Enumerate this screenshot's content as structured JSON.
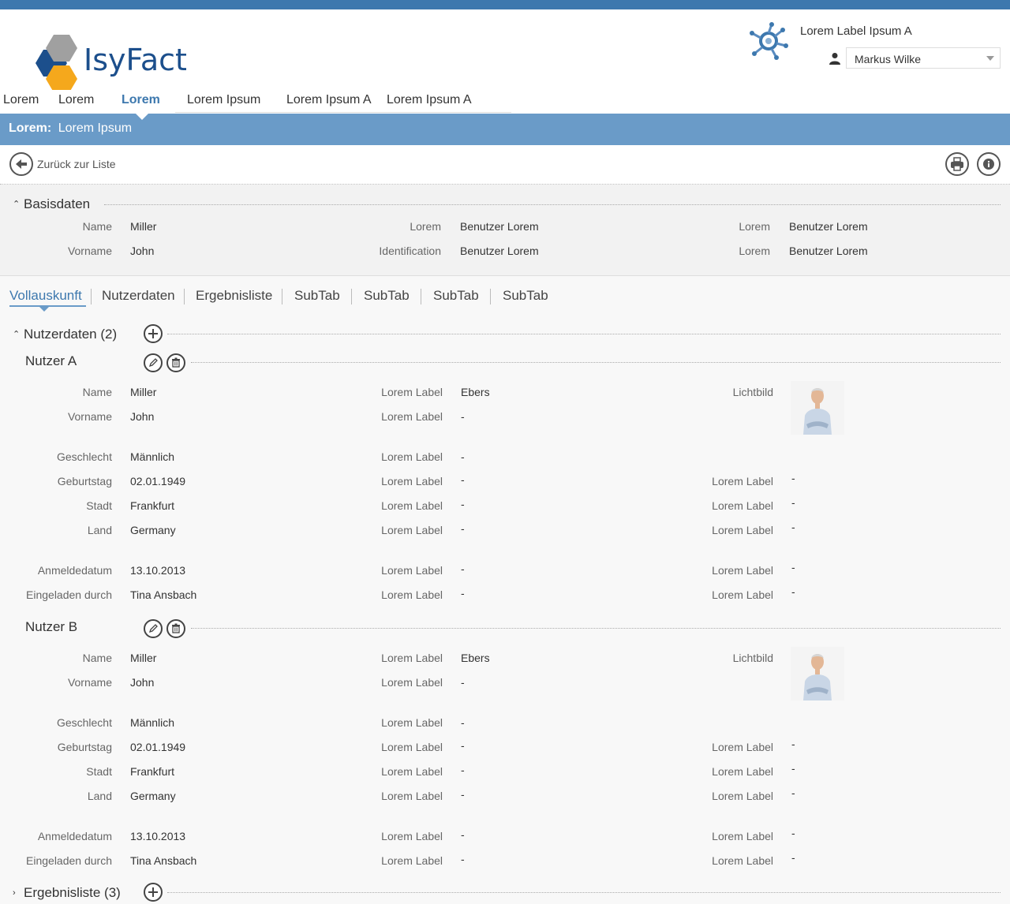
{
  "header": {
    "logo_text": "IsyFact",
    "app_label": "Lorem Label Ipsum A",
    "user_name": "Markus Wilke",
    "nav": [
      "Lorem",
      "Lorem",
      "Lorem",
      "Lorem Ipsum",
      "Lorem Ipsum A",
      "Lorem Ipsum A"
    ],
    "nav_active_index": 2
  },
  "title_bar": {
    "prefix": "Lorem:",
    "title": "Lorem Ipsum"
  },
  "toolbar": {
    "back_label": "Zurück zur Liste"
  },
  "basisdaten": {
    "title": "Basisdaten",
    "rows": [
      {
        "l1": "Name",
        "v1": "Miller",
        "l2": "Lorem",
        "v2": "Benutzer Lorem",
        "l3": "Lorem",
        "v3": "Benutzer Lorem"
      },
      {
        "l1": "Vorname",
        "v1": "John",
        "l2": "Identification",
        "v2": "Benutzer Lorem",
        "l3": "Lorem",
        "v3": "Benutzer Lorem"
      }
    ]
  },
  "tabs": [
    "Vollauskunft",
    "Nutzerdaten",
    "Ergebnisliste",
    "SubTab",
    "SubTab",
    "SubTab",
    "SubTab"
  ],
  "nutzerdaten": {
    "title": "Nutzerdaten (2)",
    "users": [
      {
        "title": "Nutzer A",
        "rows": [
          {
            "l1": "Name",
            "v1": "Miller",
            "l2": "Lorem Label",
            "v2": "Ebers",
            "l3": "Lichtbild",
            "v3": ""
          },
          {
            "l1": "Vorname",
            "v1": "John",
            "l2": "Lorem Label",
            "v2": "-",
            "l3": "",
            "v3": ""
          },
          {
            "l1": "Geschlecht",
            "v1": "Männlich",
            "l2": "Lorem Label",
            "v2": "-",
            "l3": "",
            "v3": ""
          },
          {
            "l1": "Geburtstag",
            "v1": "02.01.1949",
            "l2": "Lorem Label",
            "v2": "-",
            "l3": "Lorem Label",
            "v3": "-"
          },
          {
            "l1": "Stadt",
            "v1": "Frankfurt",
            "l2": "Lorem Label",
            "v2": "-",
            "l3": "Lorem Label",
            "v3": "-"
          },
          {
            "l1": "Land",
            "v1": "Germany",
            "l2": "Lorem Label",
            "v2": "-",
            "l3": "Lorem Label",
            "v3": "-"
          },
          {
            "l1": "Anmeldedatum",
            "v1": "13.10.2013",
            "l2": "Lorem Label",
            "v2": "-",
            "l3": "Lorem Label",
            "v3": "-"
          },
          {
            "l1": "Eingeladen durch",
            "v1": "Tina Ansbach",
            "l2": "Lorem Label",
            "v2": "-",
            "l3": "Lorem Label",
            "v3": "-"
          }
        ]
      },
      {
        "title": "Nutzer B",
        "rows": [
          {
            "l1": "Name",
            "v1": "Miller",
            "l2": "Lorem Label",
            "v2": "Ebers",
            "l3": "Lichtbild",
            "v3": ""
          },
          {
            "l1": "Vorname",
            "v1": "John",
            "l2": "Lorem Label",
            "v2": "-",
            "l3": "",
            "v3": ""
          },
          {
            "l1": "Geschlecht",
            "v1": "Männlich",
            "l2": "Lorem Label",
            "v2": "-",
            "l3": "",
            "v3": ""
          },
          {
            "l1": "Geburtstag",
            "v1": "02.01.1949",
            "l2": "Lorem Label",
            "v2": "-",
            "l3": "Lorem Label",
            "v3": "-"
          },
          {
            "l1": "Stadt",
            "v1": "Frankfurt",
            "l2": "Lorem Label",
            "v2": "-",
            "l3": "Lorem Label",
            "v3": "-"
          },
          {
            "l1": "Land",
            "v1": "Germany",
            "l2": "Lorem Label",
            "v2": "-",
            "l3": "Lorem Label",
            "v3": "-"
          },
          {
            "l1": "Anmeldedatum",
            "v1": "13.10.2013",
            "l2": "Lorem Label",
            "v2": "-",
            "l3": "Lorem Label",
            "v3": "-"
          },
          {
            "l1": "Eingeladen durch",
            "v1": "Tina Ansbach",
            "l2": "Lorem Label",
            "v2": "-",
            "l3": "Lorem Label",
            "v3": "-"
          }
        ]
      }
    ]
  },
  "ergebnisliste": {
    "title": "Ergebnisliste (3)"
  },
  "colors": {
    "brand_blue": "#3d78ae",
    "title_bar": "#6a9bc8",
    "logo_orange": "#f5a81c",
    "logo_gray": "#a0a0a0"
  },
  "icons": [
    "back-arrow-icon",
    "print-icon",
    "info-icon",
    "plus-icon",
    "pencil-icon",
    "trash-icon",
    "user-icon",
    "app-network-icon",
    "chevron-up-icon",
    "chevron-right-icon"
  ]
}
